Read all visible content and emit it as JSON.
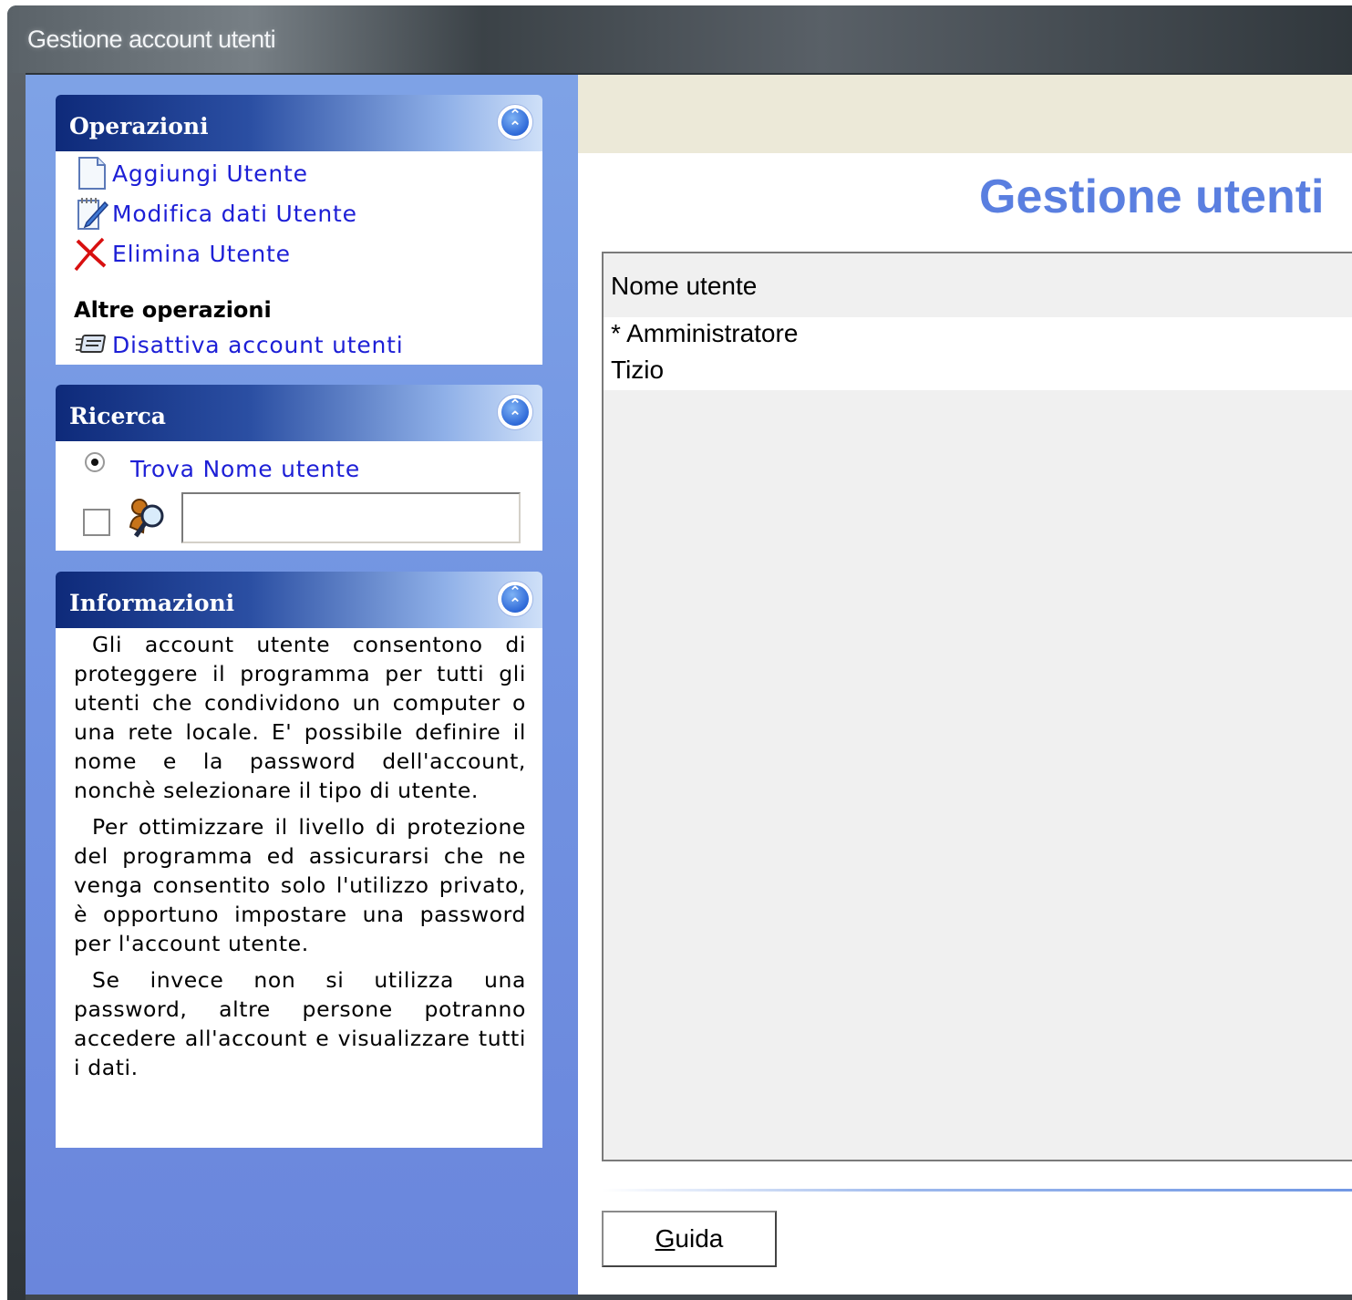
{
  "window": {
    "title": "Gestione account utenti"
  },
  "panels": {
    "operazioni": {
      "title": "Operazioni",
      "items": [
        {
          "label": "Aggiungi Utente",
          "icon": "new-document-icon"
        },
        {
          "label": "Modifica dati Utente",
          "icon": "edit-document-icon"
        },
        {
          "label": "Elimina Utente",
          "icon": "delete-x-icon"
        }
      ],
      "other_title": "Altre operazioni",
      "other_items": [
        {
          "label": "Disattiva account utenti",
          "icon": "disable-account-icon"
        }
      ]
    },
    "ricerca": {
      "title": "Ricerca",
      "radio_label": "Trova Nome utente",
      "radio_checked": true,
      "checkbox_checked": false,
      "search_value": "",
      "search_icon": "search-users-icon"
    },
    "informazioni": {
      "title": "Informazioni",
      "paragraphs": [
        "Gli account utente consentono di proteggere il programma per tutti gli utenti che condividono un computer o una rete locale. E' possibile definire il nome e la password dell'account, nonchè selezionare il tipo di utente.",
        "Per ottimizzare il livello di protezione del programma ed assicurarsi che ne venga consentito solo l'utilizzo privato, è opportuno impostare una password per l'account utente.",
        "Se invece non si utilizza una password, altre persone potranno accedere all'account e visualizzare tutti i dati."
      ]
    }
  },
  "main": {
    "title": "Gestione utenti",
    "list": {
      "column_header": "Nome utente",
      "rows": [
        {
          "name": "* Amministratore"
        },
        {
          "name": "Tizio"
        }
      ]
    },
    "guida_button": {
      "accel": "G",
      "rest": "uida"
    }
  },
  "colors": {
    "pane_blue": "#7294e2",
    "header_dark": "#0e2a7a",
    "link": "#1d1fd6",
    "title_blue": "#5a7fe0",
    "band_beige": "#ece9d8"
  }
}
